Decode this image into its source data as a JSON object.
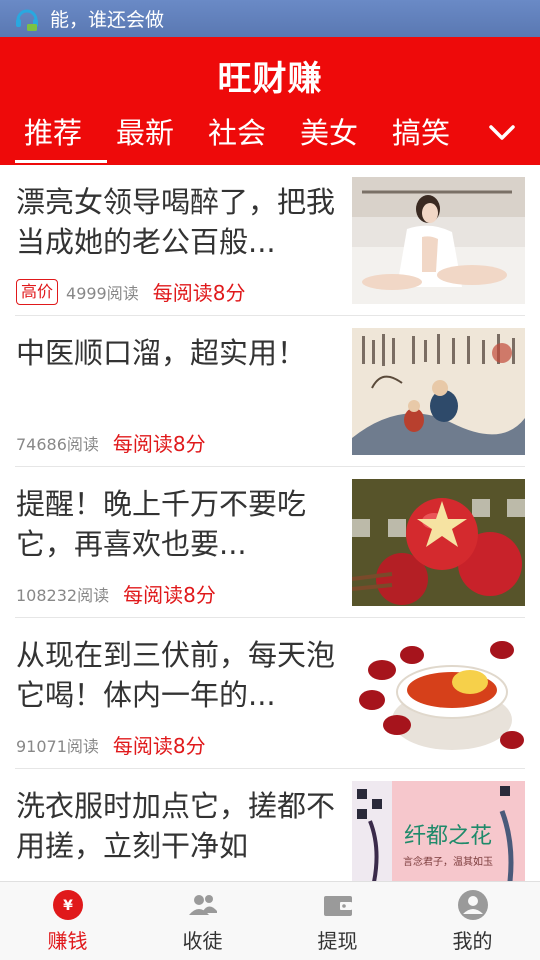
{
  "status_bar": {
    "text": "能，谁还会做",
    "icon": "headset-icon"
  },
  "header": {
    "title": "旺财赚"
  },
  "tabs": [
    {
      "label": "推荐",
      "active": true
    },
    {
      "label": "最新"
    },
    {
      "label": "社会"
    },
    {
      "label": "美女"
    },
    {
      "label": "搞笑"
    }
  ],
  "articles": [
    {
      "title": "漂亮女领导喝醉了，把我当成她的老公百般...",
      "badge": "高价",
      "reads": "4999阅读",
      "reward": "每阅读8分"
    },
    {
      "title": "中医顺口溜，超实用！",
      "badge": "",
      "reads": "74686阅读",
      "reward": "每阅读8分"
    },
    {
      "title": "提醒！晚上千万不要吃它，再喜欢也要...",
      "badge": "",
      "reads": "108232阅读",
      "reward": "每阅读8分"
    },
    {
      "title": "从现在到三伏前，每天泡它喝！体内一年的...",
      "badge": "",
      "reads": "91071阅读",
      "reward": "每阅读8分"
    },
    {
      "title": "洗衣服时加点它，搓都不用搓，立刻干净如",
      "badge": "",
      "reads": "",
      "reward": ""
    }
  ],
  "thumb_texts": {
    "calligraphy_title": "纤都之花",
    "calligraphy_sub": "言念君子，温其如玉"
  },
  "bottom_nav": [
    {
      "label": "赚钱",
      "icon": "yuan-coin-icon",
      "active": true
    },
    {
      "label": "收徒",
      "icon": "users-icon"
    },
    {
      "label": "提现",
      "icon": "wallet-icon"
    },
    {
      "label": "我的",
      "icon": "profile-icon"
    }
  ],
  "colors": {
    "brand_red": "#ee0a0a",
    "accent_red": "#e0191b",
    "status_blue": "#6a8ac6"
  }
}
